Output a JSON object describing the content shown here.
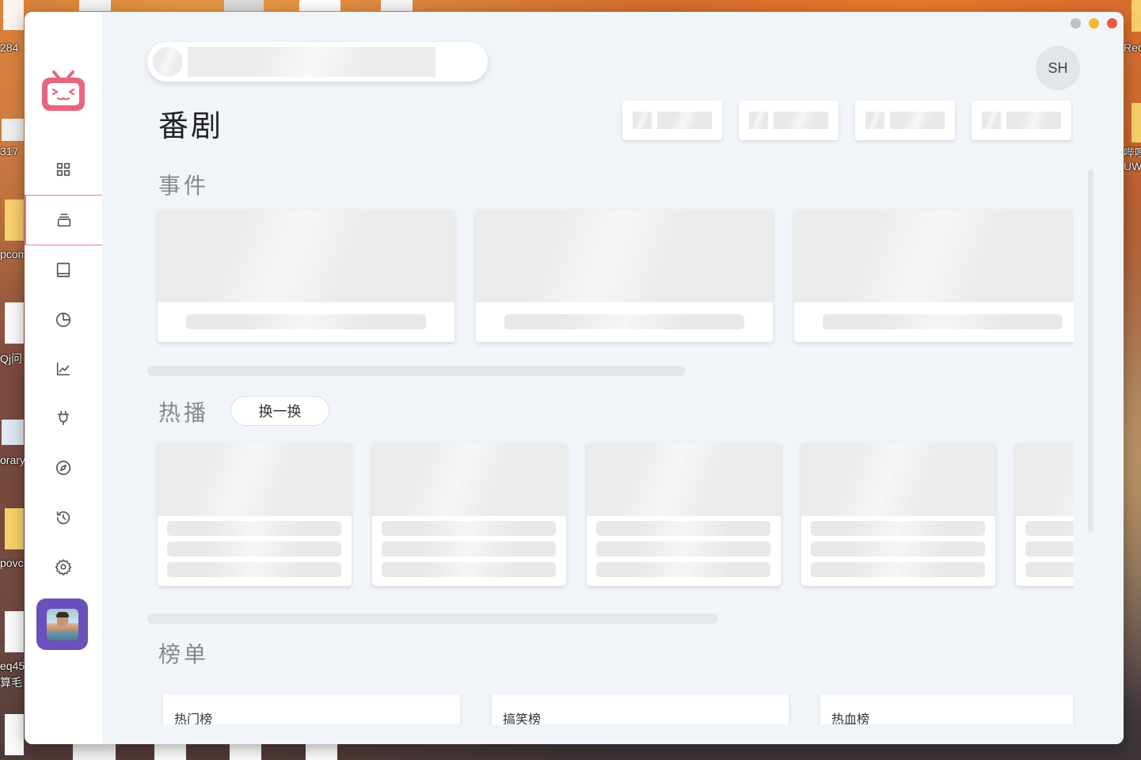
{
  "desktop": {
    "labels": [
      "284",
      "317",
      "pcom",
      "Qj问",
      "orary",
      "povc",
      "eq45",
      "算毛",
      "Rec",
      "哔哩",
      "UW"
    ]
  },
  "window": {
    "traffic_colors": [
      "#b9c3c3",
      "#f5b82e",
      "#f2554a"
    ]
  },
  "sidebar": {
    "logo_icon": "bilibili-tv-icon",
    "items": [
      {
        "name": "home",
        "icon": "grid-icon"
      },
      {
        "name": "bangumi",
        "icon": "stack-icon",
        "active": true
      },
      {
        "name": "library",
        "icon": "book-icon"
      },
      {
        "name": "stats",
        "icon": "pie-chart-icon"
      },
      {
        "name": "trends",
        "icon": "line-chart-icon"
      },
      {
        "name": "plugins",
        "icon": "plug-icon"
      },
      {
        "name": "explore",
        "icon": "compass-icon"
      },
      {
        "name": "history",
        "icon": "history-icon"
      },
      {
        "name": "settings",
        "icon": "gear-icon"
      }
    ],
    "accent": "#e07b9a"
  },
  "header": {
    "user_initials": "SH",
    "page_title": "番剧"
  },
  "sections": {
    "events_title": "事件",
    "hot_title": "热播",
    "refresh_label": "换一换",
    "rank_title": "榜单"
  },
  "rankings": [
    "热门榜",
    "搞笑榜",
    "热血榜"
  ]
}
